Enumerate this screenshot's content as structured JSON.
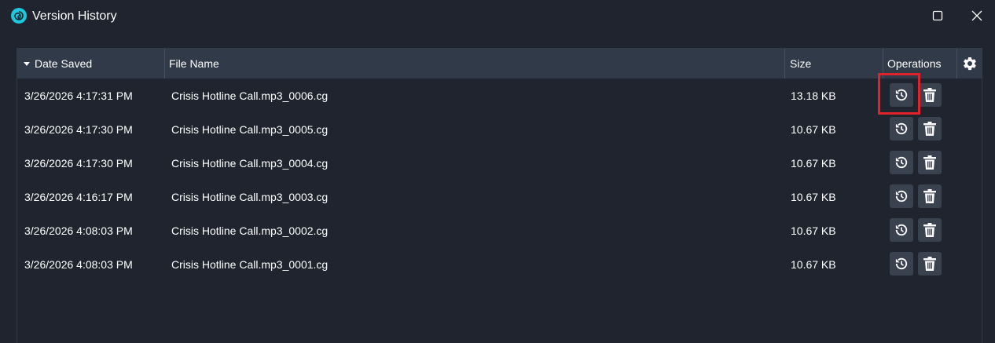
{
  "window": {
    "title": "Version History",
    "icon": "swirl-logo-icon",
    "accent_color": "#1ec8dc"
  },
  "table": {
    "columns": {
      "date_saved": "Date Saved",
      "file_name": "File Name",
      "size": "Size",
      "operations": "Operations"
    },
    "sort": {
      "column": "date_saved",
      "direction": "descending"
    },
    "rows": [
      {
        "date": "3/26/2026 4:17:31 PM",
        "file": "Crisis Hotline Call.mp3_0006.cg",
        "size": "13.18 KB"
      },
      {
        "date": "3/26/2026 4:17:30 PM",
        "file": "Crisis Hotline Call.mp3_0005.cg",
        "size": "10.67 KB"
      },
      {
        "date": "3/26/2026 4:17:30 PM",
        "file": "Crisis Hotline Call.mp3_0004.cg",
        "size": "10.67 KB"
      },
      {
        "date": "3/26/2026 4:16:17 PM",
        "file": "Crisis Hotline Call.mp3_0003.cg",
        "size": "10.67 KB"
      },
      {
        "date": "3/26/2026 4:08:03 PM",
        "file": "Crisis Hotline Call.mp3_0002.cg",
        "size": "10.67 KB"
      },
      {
        "date": "3/26/2026 4:08:03 PM",
        "file": "Crisis Hotline Call.mp3_0001.cg",
        "size": "10.67 KB"
      }
    ],
    "row_operations": [
      "restore-icon",
      "trash-icon"
    ]
  },
  "highlight_color": "#e0222a"
}
